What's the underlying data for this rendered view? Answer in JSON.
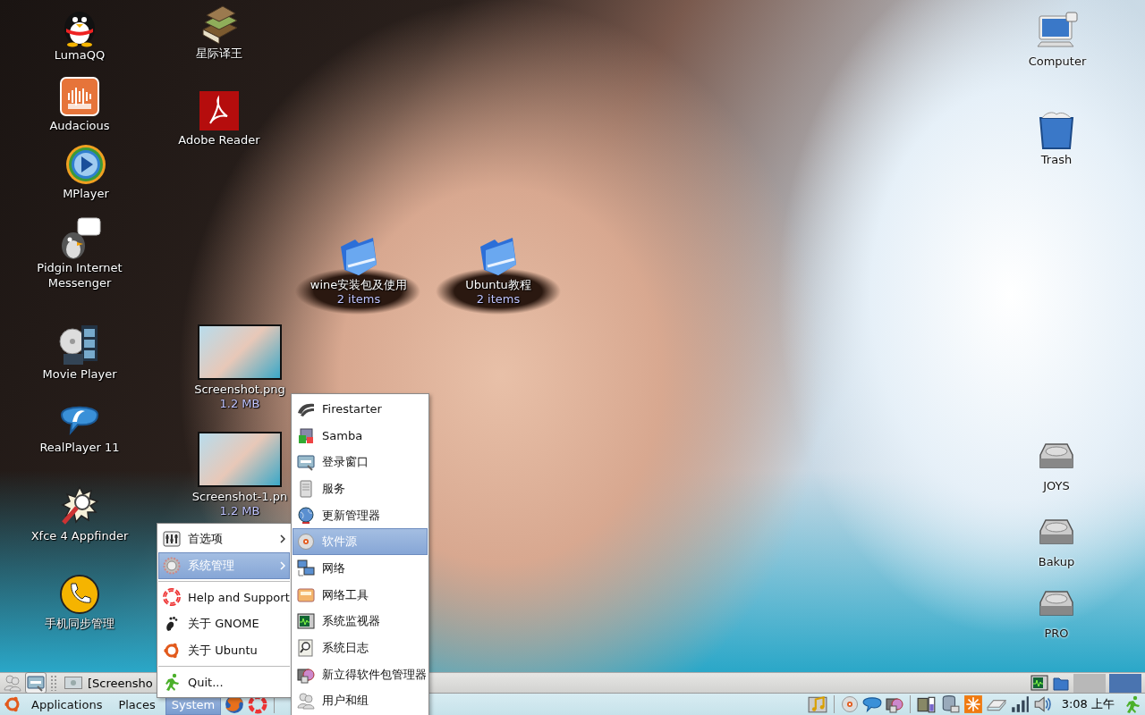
{
  "desktop_icons": [
    {
      "kind": "qq",
      "label": "LumaQQ"
    },
    {
      "kind": "audio",
      "label": "Audacious"
    },
    {
      "kind": "play",
      "label": "MPlayer"
    },
    {
      "kind": "chat",
      "label": "Pidgin Internet Messenger"
    },
    {
      "kind": "film",
      "label": "Movie Player"
    },
    {
      "kind": "real",
      "label": "RealPlayer 11"
    },
    {
      "kind": "finder",
      "label": "Xfce 4 Appfinder"
    },
    {
      "kind": "phone",
      "label": "手机同步管理"
    },
    {
      "kind": "books",
      "label": "星际译王"
    },
    {
      "kind": "pdf",
      "label": "Adobe Reader"
    },
    {
      "kind": "image",
      "label": "Screenshot.png",
      "sublabel": "1.2 MB"
    },
    {
      "kind": "image",
      "label": "Screenshot-1.pn",
      "sublabel": "1.2 MB"
    },
    {
      "kind": "folder",
      "label": "wine安装包及使用",
      "sublabel": "2 items"
    },
    {
      "kind": "folder",
      "label": "Ubuntu教程",
      "sublabel": "2 items"
    },
    {
      "kind": "computer",
      "label": "Computer"
    },
    {
      "kind": "trash",
      "label": "Trash"
    },
    {
      "kind": "drive",
      "label": "JOYS"
    },
    {
      "kind": "drive",
      "label": "Bakup"
    },
    {
      "kind": "drive",
      "label": "PRO"
    }
  ],
  "top_panel": {
    "window_buttons": [
      {
        "title": "[Screensho"
      }
    ],
    "workspaces": [
      {
        "selected": false
      },
      {
        "selected": true
      }
    ]
  },
  "bottom_panel": {
    "menus": [
      {
        "label": "Applications",
        "selected": false
      },
      {
        "label": "Places",
        "selected": false
      },
      {
        "label": "System",
        "selected": true
      }
    ],
    "clock": "3:08 上午"
  },
  "system_menu": {
    "items": [
      {
        "kind": "submenu",
        "label": "首选项",
        "selected": false
      },
      {
        "kind": "submenu",
        "label": "系统管理",
        "selected": true
      },
      {
        "kind": "separator"
      },
      {
        "kind": "item",
        "label": "Help and Support",
        "selected": false
      },
      {
        "kind": "item",
        "label": "关于 GNOME",
        "selected": false
      },
      {
        "kind": "item",
        "label": "关于 Ubuntu",
        "selected": false
      },
      {
        "kind": "separator"
      },
      {
        "kind": "item",
        "label": "Quit...",
        "selected": false
      }
    ]
  },
  "admin_submenu": {
    "items": [
      {
        "label": "Firestarter",
        "selected": false
      },
      {
        "label": "Samba",
        "selected": false
      },
      {
        "label": "登录窗口",
        "selected": false
      },
      {
        "label": "服务",
        "selected": false
      },
      {
        "label": "更新管理器",
        "selected": false
      },
      {
        "label": "软件源",
        "selected": true
      },
      {
        "label": "网络",
        "selected": false
      },
      {
        "label": "网络工具",
        "selected": false
      },
      {
        "label": "系统监视器",
        "selected": false
      },
      {
        "label": "系统日志",
        "selected": false
      },
      {
        "label": "新立得软件包管理器",
        "selected": false
      },
      {
        "label": "用户和组",
        "selected": false
      }
    ]
  }
}
